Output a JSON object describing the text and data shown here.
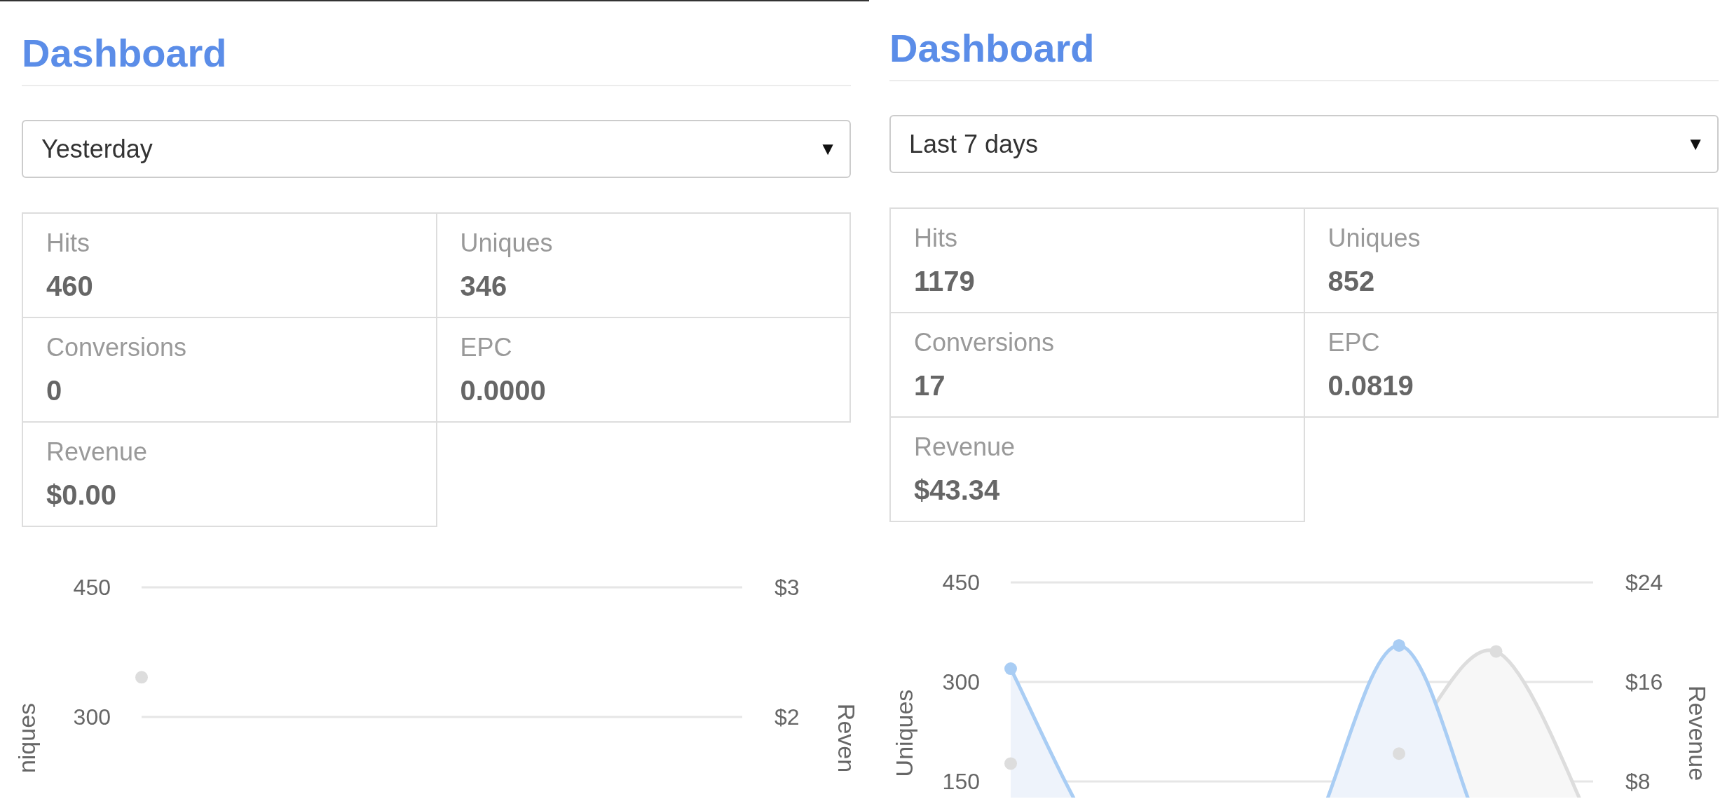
{
  "panels": [
    {
      "title": "Dashboard",
      "range": {
        "value": "Yesterday",
        "caret": "▼"
      },
      "stats": [
        {
          "label": "Hits",
          "value": "460"
        },
        {
          "label": "Uniques",
          "value": "346"
        },
        {
          "label": "Conversions",
          "value": "0"
        },
        {
          "label": "EPC",
          "value": "0.0000"
        },
        {
          "label": "Revenue",
          "value": "$0.00"
        }
      ],
      "chart": {
        "kind": "single-point",
        "left_title": "niques",
        "right_title": "Reven",
        "left_ticks": [
          "450",
          "300"
        ],
        "right_ticks": [
          "$3",
          "$2"
        ]
      }
    },
    {
      "title": "Dashboard",
      "range": {
        "value": "Last 7 days",
        "caret": "▼"
      },
      "stats": [
        {
          "label": "Hits",
          "value": "1179"
        },
        {
          "label": "Uniques",
          "value": "852"
        },
        {
          "label": "Conversions",
          "value": "17"
        },
        {
          "label": "EPC",
          "value": "0.0819"
        },
        {
          "label": "Revenue",
          "value": "$43.34"
        }
      ],
      "chart": {
        "kind": "two-curves",
        "left_title": "Uniques",
        "right_title": "Revenue",
        "left_ticks": [
          "450",
          "300",
          "150"
        ],
        "right_ticks": [
          "$24",
          "$16",
          "$8"
        ]
      }
    }
  ]
}
